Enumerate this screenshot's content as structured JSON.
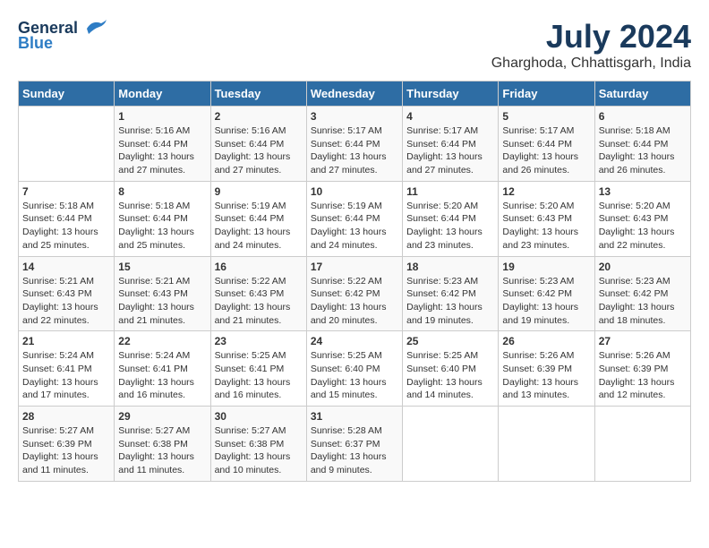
{
  "header": {
    "logo_general": "General",
    "logo_blue": "Blue",
    "month_title": "July 2024",
    "location": "Gharghoda, Chhattisgarh, India"
  },
  "days_of_week": [
    "Sunday",
    "Monday",
    "Tuesday",
    "Wednesday",
    "Thursday",
    "Friday",
    "Saturday"
  ],
  "weeks": [
    [
      {
        "day": "",
        "info": ""
      },
      {
        "day": "1",
        "info": "Sunrise: 5:16 AM\nSunset: 6:44 PM\nDaylight: 13 hours and 27 minutes."
      },
      {
        "day": "2",
        "info": "Sunrise: 5:16 AM\nSunset: 6:44 PM\nDaylight: 13 hours and 27 minutes."
      },
      {
        "day": "3",
        "info": "Sunrise: 5:17 AM\nSunset: 6:44 PM\nDaylight: 13 hours and 27 minutes."
      },
      {
        "day": "4",
        "info": "Sunrise: 5:17 AM\nSunset: 6:44 PM\nDaylight: 13 hours and 27 minutes."
      },
      {
        "day": "5",
        "info": "Sunrise: 5:17 AM\nSunset: 6:44 PM\nDaylight: 13 hours and 26 minutes."
      },
      {
        "day": "6",
        "info": "Sunrise: 5:18 AM\nSunset: 6:44 PM\nDaylight: 13 hours and 26 minutes."
      }
    ],
    [
      {
        "day": "7",
        "info": "Sunrise: 5:18 AM\nSunset: 6:44 PM\nDaylight: 13 hours and 25 minutes."
      },
      {
        "day": "8",
        "info": "Sunrise: 5:18 AM\nSunset: 6:44 PM\nDaylight: 13 hours and 25 minutes."
      },
      {
        "day": "9",
        "info": "Sunrise: 5:19 AM\nSunset: 6:44 PM\nDaylight: 13 hours and 24 minutes."
      },
      {
        "day": "10",
        "info": "Sunrise: 5:19 AM\nSunset: 6:44 PM\nDaylight: 13 hours and 24 minutes."
      },
      {
        "day": "11",
        "info": "Sunrise: 5:20 AM\nSunset: 6:44 PM\nDaylight: 13 hours and 23 minutes."
      },
      {
        "day": "12",
        "info": "Sunrise: 5:20 AM\nSunset: 6:43 PM\nDaylight: 13 hours and 23 minutes."
      },
      {
        "day": "13",
        "info": "Sunrise: 5:20 AM\nSunset: 6:43 PM\nDaylight: 13 hours and 22 minutes."
      }
    ],
    [
      {
        "day": "14",
        "info": "Sunrise: 5:21 AM\nSunset: 6:43 PM\nDaylight: 13 hours and 22 minutes."
      },
      {
        "day": "15",
        "info": "Sunrise: 5:21 AM\nSunset: 6:43 PM\nDaylight: 13 hours and 21 minutes."
      },
      {
        "day": "16",
        "info": "Sunrise: 5:22 AM\nSunset: 6:43 PM\nDaylight: 13 hours and 21 minutes."
      },
      {
        "day": "17",
        "info": "Sunrise: 5:22 AM\nSunset: 6:42 PM\nDaylight: 13 hours and 20 minutes."
      },
      {
        "day": "18",
        "info": "Sunrise: 5:23 AM\nSunset: 6:42 PM\nDaylight: 13 hours and 19 minutes."
      },
      {
        "day": "19",
        "info": "Sunrise: 5:23 AM\nSunset: 6:42 PM\nDaylight: 13 hours and 19 minutes."
      },
      {
        "day": "20",
        "info": "Sunrise: 5:23 AM\nSunset: 6:42 PM\nDaylight: 13 hours and 18 minutes."
      }
    ],
    [
      {
        "day": "21",
        "info": "Sunrise: 5:24 AM\nSunset: 6:41 PM\nDaylight: 13 hours and 17 minutes."
      },
      {
        "day": "22",
        "info": "Sunrise: 5:24 AM\nSunset: 6:41 PM\nDaylight: 13 hours and 16 minutes."
      },
      {
        "day": "23",
        "info": "Sunrise: 5:25 AM\nSunset: 6:41 PM\nDaylight: 13 hours and 16 minutes."
      },
      {
        "day": "24",
        "info": "Sunrise: 5:25 AM\nSunset: 6:40 PM\nDaylight: 13 hours and 15 minutes."
      },
      {
        "day": "25",
        "info": "Sunrise: 5:25 AM\nSunset: 6:40 PM\nDaylight: 13 hours and 14 minutes."
      },
      {
        "day": "26",
        "info": "Sunrise: 5:26 AM\nSunset: 6:39 PM\nDaylight: 13 hours and 13 minutes."
      },
      {
        "day": "27",
        "info": "Sunrise: 5:26 AM\nSunset: 6:39 PM\nDaylight: 13 hours and 12 minutes."
      }
    ],
    [
      {
        "day": "28",
        "info": "Sunrise: 5:27 AM\nSunset: 6:39 PM\nDaylight: 13 hours and 11 minutes."
      },
      {
        "day": "29",
        "info": "Sunrise: 5:27 AM\nSunset: 6:38 PM\nDaylight: 13 hours and 11 minutes."
      },
      {
        "day": "30",
        "info": "Sunrise: 5:27 AM\nSunset: 6:38 PM\nDaylight: 13 hours and 10 minutes."
      },
      {
        "day": "31",
        "info": "Sunrise: 5:28 AM\nSunset: 6:37 PM\nDaylight: 13 hours and 9 minutes."
      },
      {
        "day": "",
        "info": ""
      },
      {
        "day": "",
        "info": ""
      },
      {
        "day": "",
        "info": ""
      }
    ]
  ]
}
